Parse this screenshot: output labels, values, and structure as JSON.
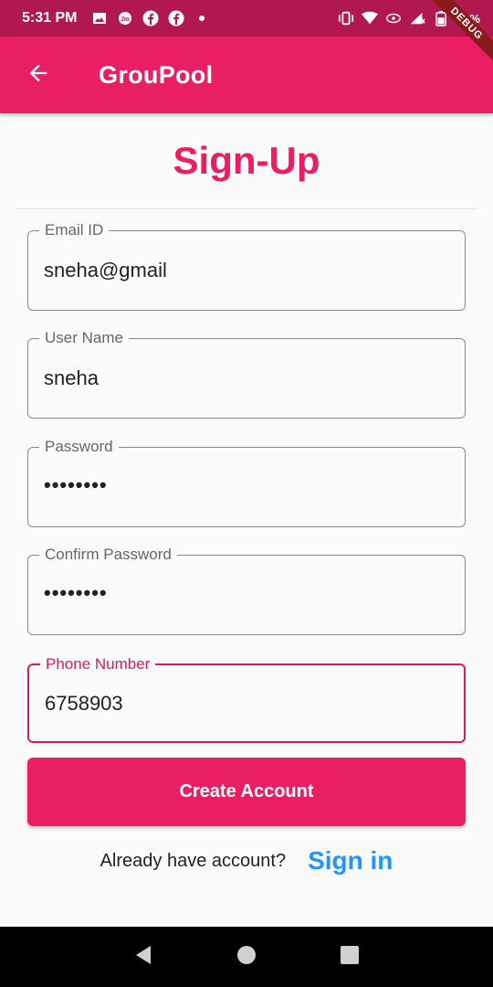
{
  "status_bar": {
    "time": "5:31 PM",
    "battery": "60%",
    "left_icons": [
      "gallery-icon",
      "jio-icon",
      "facebook-icon",
      "facebook-icon",
      "dot-icon"
    ],
    "right_icons": [
      "vibrate-icon",
      "wifi-icon",
      "hotspot-icon",
      "signal-icon",
      "battery-icon"
    ]
  },
  "debug_banner": "DEBUG",
  "app_bar": {
    "title": "GrouPool",
    "back_icon": "arrow-back-icon",
    "background_color": "#e91e63"
  },
  "page": {
    "title": "Sign-Up",
    "title_color": "#e91e63"
  },
  "form": {
    "email": {
      "label": "Email ID",
      "value": "sneha@gmail"
    },
    "username": {
      "label": "User Name",
      "value": "sneha"
    },
    "password": {
      "label": "Password",
      "value": "••••••••"
    },
    "confirm_password": {
      "label": "Confirm Password",
      "value": "••••••••"
    },
    "phone": {
      "label": "Phone Number",
      "value": "6758903",
      "focused": true
    }
  },
  "create_button": {
    "label": "Create Account"
  },
  "signin": {
    "prompt": "Already have account?",
    "link": "Sign in",
    "link_color": "#2196f3"
  },
  "nav_bar": {
    "buttons": [
      "back-triangle-icon",
      "home-circle-icon",
      "recents-square-icon"
    ]
  }
}
